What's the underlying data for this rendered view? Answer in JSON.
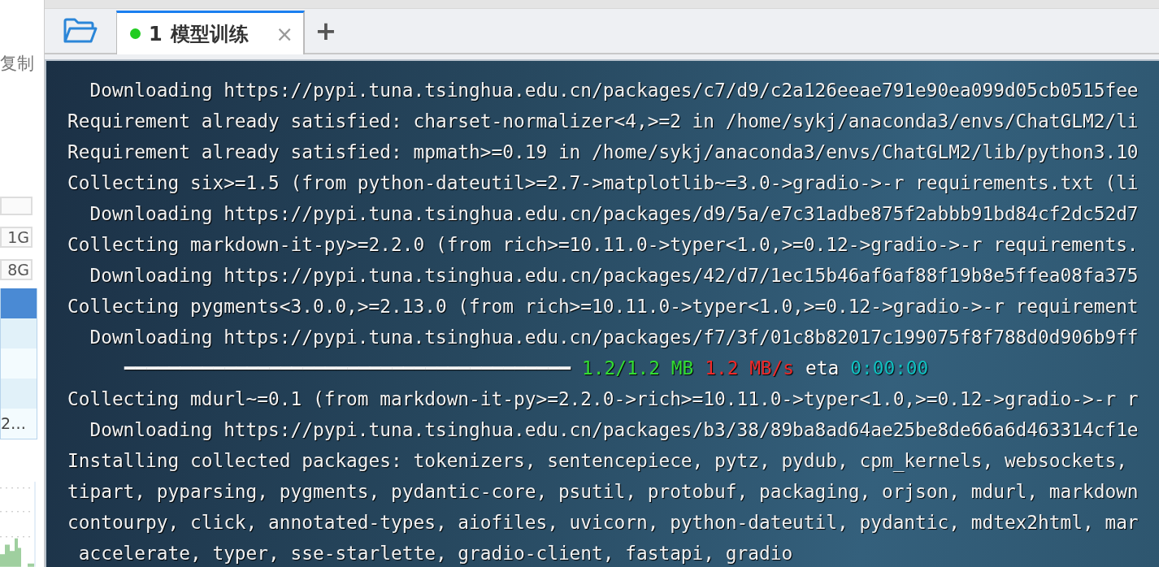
{
  "sidebar": {
    "action": "复制",
    "fields": [
      "1G",
      "8G"
    ],
    "rows": [
      {
        "selected": true
      },
      {
        "selected": false
      },
      {
        "selected": false
      },
      {
        "selected": false
      },
      {
        "selected": false,
        "cell": "2…"
      }
    ]
  },
  "tabs": [
    {
      "index": "1",
      "label": "模型训练",
      "selected": true,
      "color": "#22cc22",
      "close": "×"
    }
  ],
  "add_tab": "+",
  "terminal": [
    {
      "kind": "text",
      "text": "  Downloading https://pypi.tuna.tsinghua.edu.cn/packages/c7/d9/c2a126eeae791e90ea099d05cb0515fee"
    },
    {
      "kind": "text",
      "text": "Requirement already satisfied: charset-normalizer<4,>=2 in /home/sykj/anaconda3/envs/ChatGLM2/li"
    },
    {
      "kind": "text",
      "text": "Requirement already satisfied: mpmath>=0.19 in /home/sykj/anaconda3/envs/ChatGLM2/lib/python3.10"
    },
    {
      "kind": "text",
      "text": "Collecting six>=1.5 (from python-dateutil>=2.7->matplotlib~=3.0->gradio->-r requirements.txt (li"
    },
    {
      "kind": "text",
      "text": "  Downloading https://pypi.tuna.tsinghua.edu.cn/packages/d9/5a/e7c31adbe875f2abbb91bd84cf2dc52d7"
    },
    {
      "kind": "text",
      "text": "Collecting markdown-it-py>=2.2.0 (from rich>=10.11.0->typer<1.0,>=0.12->gradio->-r requirements."
    },
    {
      "kind": "text",
      "text": "  Downloading https://pypi.tuna.tsinghua.edu.cn/packages/42/d7/1ec15b46af6af88f19b8e5ffea08fa375"
    },
    {
      "kind": "text",
      "text": "Collecting pygments<3.0.0,>=2.13.0 (from rich>=10.11.0->typer<1.0,>=0.12->gradio->-r requirement"
    },
    {
      "kind": "text",
      "text": "  Downloading https://pypi.tuna.tsinghua.edu.cn/packages/f7/3f/01c8b82017c199075f8f788d0d906b9ff"
    },
    {
      "kind": "progress",
      "segments": [
        {
          "text": "━━━━━━━━━━━━━━━━━━━━━━━━━━━━━━━━━━━━━━━━",
          "color": "#f4f4f4"
        },
        {
          "text": "1.2/1.2 MB",
          "color": "#33dd33"
        },
        {
          "text": "1.2 MB/s",
          "color": "#ee2a2a"
        },
        {
          "text": "eta",
          "color": "#ffffff"
        },
        {
          "text": "0:00:00",
          "color": "#10c0c0"
        }
      ]
    },
    {
      "kind": "text",
      "text": "Collecting mdurl~=0.1 (from markdown-it-py>=2.2.0->rich>=10.11.0->typer<1.0,>=0.12->gradio->-r r"
    },
    {
      "kind": "text",
      "text": "  Downloading https://pypi.tuna.tsinghua.edu.cn/packages/b3/38/89ba8ad64ae25be8de66a6d463314cf1e"
    },
    {
      "kind": "text",
      "text": "Installing collected packages: tokenizers, sentencepiece, pytz, pydub, cpm_kernels, websockets,"
    },
    {
      "kind": "text",
      "text": "tipart, pyparsing, pygments, pydantic-core, psutil, protobuf, packaging, orjson, mdurl, markdown"
    },
    {
      "kind": "text",
      "text": "contourpy, click, annotated-types, aiofiles, uvicorn, python-dateutil, pydantic, mdtex2html, mar"
    },
    {
      "kind": "text",
      "text": " accelerate, typer, sse-starlette, gradio-client, fastapi, gradio"
    }
  ]
}
